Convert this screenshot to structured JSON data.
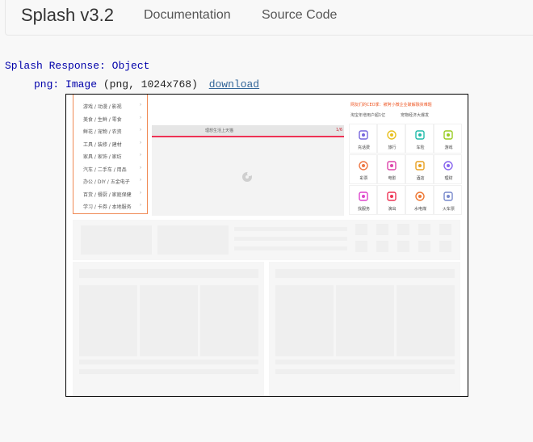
{
  "navbar": {
    "brand": "Splash v3.2",
    "links": [
      {
        "label": "Documentation"
      },
      {
        "label": "Source Code"
      }
    ]
  },
  "response": {
    "header_key": "Splash Response",
    "header_sep": ":",
    "header_type": "Object",
    "png_key": "png",
    "png_sep": ":",
    "png_type": "Image",
    "png_meta": "(png, 1024x768)",
    "download_label": "download"
  },
  "screenshot": {
    "menu_items": [
      "游戏 / 动漫 / 影视",
      "美食 / 生鲜 / 零食",
      "鲜花 / 宠物 / 农资",
      "工具 / 装修 / 建材",
      "家具 / 家饰 / 家纺",
      "汽车 / 二手车 / 用品",
      "办公 / DIY / 五金电子",
      "百货 / 餐厨 / 家庭保健",
      "学习 / 卡券 / 本地服务"
    ],
    "arrow": "›",
    "banner_title": "理想生活上天猫",
    "banner_page": "1/6",
    "notice": "网友们的CEO季：被阿小微企业破解融资难题",
    "sub_left": "淘宝年增用户超1亿",
    "sub_right": "宠物经济大爆发",
    "services": [
      {
        "label": "充话费",
        "color": "#7766dd"
      },
      {
        "label": "旅行",
        "color": "#e8c020"
      },
      {
        "label": "车险",
        "color": "#22bbaa"
      },
      {
        "label": "游戏",
        "color": "#99cc22"
      },
      {
        "label": "彩票",
        "color": "#ee7744"
      },
      {
        "label": "电影",
        "color": "#dd44aa"
      },
      {
        "label": "酒店",
        "color": "#e8a020"
      },
      {
        "label": "理财",
        "color": "#8866ee"
      },
      {
        "label": "找服务",
        "color": "#dd44cc"
      },
      {
        "label": "演出",
        "color": "#ee3355"
      },
      {
        "label": "水电煤",
        "color": "#ee7733"
      },
      {
        "label": "火车票",
        "color": "#7788cc"
      }
    ]
  }
}
